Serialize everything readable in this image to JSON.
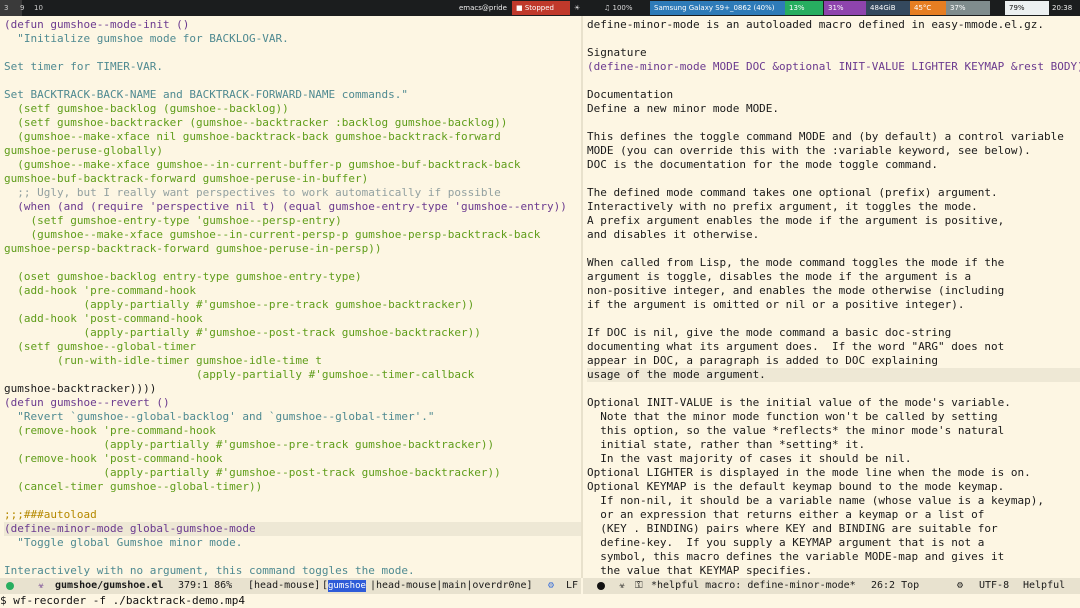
{
  "topbar": {
    "workspaces": [
      "3",
      "9",
      "10"
    ],
    "window_title": "emacs@pride",
    "stopped": "Stopped",
    "mic": "●",
    "vol": "100%",
    "phone": "Samsung Galaxy S9+_0862 (40%)",
    "cpu": "13%",
    "mem": "31%",
    "disk": "484GiB",
    "temp": "45°C",
    "load": "37%",
    "battery": "79%",
    "clock": "20:38"
  },
  "left_buffer": {
    "lines": [
      {
        "text": "(defun gumshoe--mode-init ()",
        "color": "#6b3a8f"
      },
      {
        "text": "  \"Initialize gumshoe mode for BACKLOG-VAR.",
        "color": "#4f8a91"
      },
      {
        "text": "",
        "color": "#4f8a91"
      },
      {
        "text": "Set timer for TIMER-VAR.",
        "color": "#4f8a91"
      },
      {
        "text": "",
        "color": "#4f8a91"
      },
      {
        "text": "Set BACKTRACK-BACK-NAME and BACKTRACK-FORWARD-NAME commands.\"",
        "color": "#4f8a91"
      },
      {
        "text": "  (setf gumshoe-backlog (gumshoe--backlog))",
        "color": "#5f9d1a"
      },
      {
        "text": "  (setf gumshoe-backtracker (gumshoe--backtracker :backlog gumshoe-backlog))",
        "color": "#5f9d1a"
      },
      {
        "text": "  (gumshoe--make-xface nil gumshoe-backtrack-back gumshoe-backtrack-forward",
        "color": "#5f9d1a"
      },
      {
        "text": "gumshoe-peruse-globally)",
        "color": "#5f9d1a"
      },
      {
        "text": "  (gumshoe--make-xface gumshoe--in-current-buffer-p gumshoe-buf-backtrack-back",
        "color": "#5f9d1a"
      },
      {
        "text": "gumshoe-buf-backtrack-forward gumshoe-peruse-in-buffer)",
        "color": "#5f9d1a"
      },
      {
        "text": "  ;; Ugly, but I really want perspectives to work automatically if possible",
        "color": "#93a1a1"
      },
      {
        "text": "  (when (and (require 'perspective nil t) (equal gumshoe-entry-type 'gumshoe--entry))",
        "color": "#6b3a8f"
      },
      {
        "text": "    (setf gumshoe-entry-type 'gumshoe--persp-entry)",
        "color": "#5f9d1a"
      },
      {
        "text": "    (gumshoe--make-xface gumshoe--in-current-persp-p gumshoe-persp-backtrack-back",
        "color": "#5f9d1a"
      },
      {
        "text": "gumshoe-persp-backtrack-forward gumshoe-peruse-in-persp))",
        "color": "#5f9d1a"
      },
      {
        "text": "",
        "color": "#5f9d1a"
      },
      {
        "text": "  (oset gumshoe-backlog entry-type gumshoe-entry-type)",
        "color": "#5f9d1a"
      },
      {
        "text": "  (add-hook 'pre-command-hook",
        "color": "#5f9d1a"
      },
      {
        "text": "            (apply-partially #'gumshoe--pre-track gumshoe-backtracker))",
        "color": "#5f9d1a"
      },
      {
        "text": "  (add-hook 'post-command-hook",
        "color": "#5f9d1a"
      },
      {
        "text": "            (apply-partially #'gumshoe--post-track gumshoe-backtracker))",
        "color": "#5f9d1a"
      },
      {
        "text": "  (setf gumshoe--global-timer",
        "color": "#5f9d1a"
      },
      {
        "text": "        (run-with-idle-timer gumshoe-idle-time t",
        "color": "#5f9d1a"
      },
      {
        "text": "                             (apply-partially #'gumshoe--timer-callback",
        "color": "#5f9d1a"
      },
      {
        "text": "gumshoe-backtracker))))",
        "color": "#1a1a1a"
      },
      {
        "text": "(defun gumshoe--revert ()",
        "color": "#6b3a8f"
      },
      {
        "text": "  \"Revert `gumshoe--global-backlog' and `gumshoe--global-timer'.\"",
        "color": "#4f8a91"
      },
      {
        "text": "  (remove-hook 'pre-command-hook",
        "color": "#5f9d1a"
      },
      {
        "text": "               (apply-partially #'gumshoe--pre-track gumshoe-backtracker))",
        "color": "#5f9d1a"
      },
      {
        "text": "  (remove-hook 'post-command-hook",
        "color": "#5f9d1a"
      },
      {
        "text": "               (apply-partially #'gumshoe--post-track gumshoe-backtracker))",
        "color": "#5f9d1a"
      },
      {
        "text": "  (cancel-timer gumshoe--global-timer))",
        "color": "#5f9d1a"
      },
      {
        "text": "",
        "color": "#5f9d1a"
      },
      {
        "text": ";;;###autoload",
        "color": "#b58900"
      },
      {
        "text": "(define-minor-mode global-gumshoe-mode",
        "color": "#6b3a8f"
      },
      {
        "text": "  \"Toggle global Gumshoe minor mode.",
        "color": "#4f8a91"
      },
      {
        "text": "",
        "color": "#4f8a91"
      },
      {
        "text": "Interactively with no argument, this command toggles the mode.",
        "color": "#4f8a91"
      }
    ],
    "highlight_line": 36
  },
  "right_buffer": {
    "lines": [
      {
        "text": "define-minor-mode is an autoloaded macro defined in easy-mmode.el.gz.",
        "color": "#1a1a1a"
      },
      {
        "text": "",
        "color": "#1a1a1a"
      },
      {
        "text": "Signature",
        "color": "#1a1a1a"
      },
      {
        "text": "(define-minor-mode MODE DOC &optional INIT-VALUE LIGHTER KEYMAP &rest BODY)",
        "color": "#6b3a8f"
      },
      {
        "text": "",
        "color": "#1a1a1a"
      },
      {
        "text": "Documentation",
        "color": "#1a1a1a"
      },
      {
        "text": "Define a new minor mode MODE.",
        "color": "#1a1a1a"
      },
      {
        "text": "",
        "color": "#1a1a1a"
      },
      {
        "text": "This defines the toggle command MODE and (by default) a control variable",
        "color": "#1a1a1a"
      },
      {
        "text": "MODE (you can override this with the :variable keyword, see below).",
        "color": "#1a1a1a"
      },
      {
        "text": "DOC is the documentation for the mode toggle command.",
        "color": "#1a1a1a"
      },
      {
        "text": "",
        "color": "#1a1a1a"
      },
      {
        "text": "The defined mode command takes one optional (prefix) argument.",
        "color": "#1a1a1a"
      },
      {
        "text": "Interactively with no prefix argument, it toggles the mode.",
        "color": "#1a1a1a"
      },
      {
        "text": "A prefix argument enables the mode if the argument is positive,",
        "color": "#1a1a1a"
      },
      {
        "text": "and disables it otherwise.",
        "color": "#1a1a1a"
      },
      {
        "text": "",
        "color": "#1a1a1a"
      },
      {
        "text": "When called from Lisp, the mode command toggles the mode if the",
        "color": "#1a1a1a"
      },
      {
        "text": "argument is toggle, disables the mode if the argument is a",
        "color": "#1a1a1a"
      },
      {
        "text": "non-positive integer, and enables the mode otherwise (including",
        "color": "#1a1a1a"
      },
      {
        "text": "if the argument is omitted or nil or a positive integer).",
        "color": "#1a1a1a"
      },
      {
        "text": "",
        "color": "#1a1a1a"
      },
      {
        "text": "If DOC is nil, give the mode command a basic doc-string",
        "color": "#1a1a1a"
      },
      {
        "text": "documenting what its argument does.  If the word \"ARG\" does not",
        "color": "#1a1a1a"
      },
      {
        "text": "appear in DOC, a paragraph is added to DOC explaining",
        "color": "#1a1a1a"
      },
      {
        "text": "usage of the mode argument.",
        "color": "#1a1a1a"
      },
      {
        "text": "",
        "color": "#1a1a1a"
      },
      {
        "text": "Optional INIT-VALUE is the initial value of the mode's variable.",
        "color": "#1a1a1a"
      },
      {
        "text": "  Note that the minor mode function won't be called by setting",
        "color": "#1a1a1a"
      },
      {
        "text": "  this option, so the value *reflects* the minor mode's natural",
        "color": "#1a1a1a"
      },
      {
        "text": "  initial state, rather than *setting* it.",
        "color": "#1a1a1a"
      },
      {
        "text": "  In the vast majority of cases it should be nil.",
        "color": "#1a1a1a"
      },
      {
        "text": "Optional LIGHTER is displayed in the mode line when the mode is on.",
        "color": "#1a1a1a"
      },
      {
        "text": "Optional KEYMAP is the default keymap bound to the mode keymap.",
        "color": "#1a1a1a"
      },
      {
        "text": "  If non-nil, it should be a variable name (whose value is a keymap),",
        "color": "#1a1a1a"
      },
      {
        "text": "  or an expression that returns either a keymap or a list of",
        "color": "#1a1a1a"
      },
      {
        "text": "  (KEY . BINDING) pairs where KEY and BINDING are suitable for",
        "color": "#1a1a1a"
      },
      {
        "text": "  define-key.  If you supply a KEYMAP argument that is not a",
        "color": "#1a1a1a"
      },
      {
        "text": "  symbol, this macro defines the variable MODE-map and gives it",
        "color": "#1a1a1a"
      },
      {
        "text": "  the value that KEYMAP specifies.",
        "color": "#1a1a1a"
      }
    ],
    "highlight_line": 25
  },
  "modeline_left": {
    "file": "gumshoe/gumshoe.el",
    "position": "379:1 86%",
    "modes": "[head-mouse]",
    "branch_tag": "gumshoe",
    "branch_rest": "|head-mouse|main|overdr0ne]",
    "eol": "LF"
  },
  "modeline_right": {
    "buffer": "*helpful macro: define-minor-mode*",
    "position": "26:2 Top",
    "encoding": "UTF-8",
    "major_mode": "Helpful"
  },
  "minibuffer": {
    "prompt": "$",
    "command": " wf-recorder -f ./backtrack-demo.mp4"
  },
  "colors": {
    "background": "#fdf6e3",
    "modeline": "#e8e2cf",
    "keyword": "#6b3a8f",
    "string": "#4f8a91",
    "comment": "#93a1a1",
    "symbol": "#5f9d1a"
  }
}
